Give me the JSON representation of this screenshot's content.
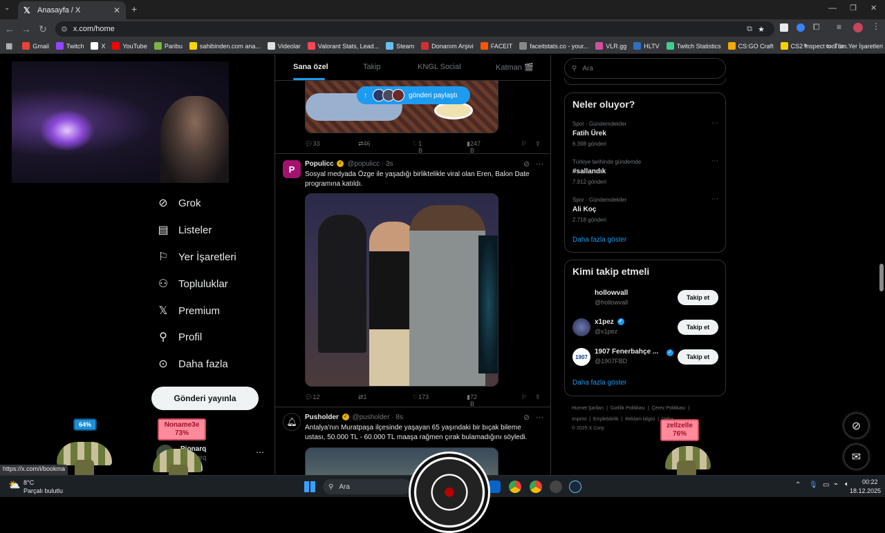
{
  "browser": {
    "tab_title": "Anasayfa / X",
    "url": "x.com/home",
    "status_url": "https://x.com/i/bookma",
    "bookmarks": [
      {
        "label": "Gmail",
        "color": "#ea4335"
      },
      {
        "label": "Twitch",
        "color": "#9146ff"
      },
      {
        "label": "X",
        "color": "#ffffff"
      },
      {
        "label": "YouTube",
        "color": "#ff0000"
      },
      {
        "label": "Paribu",
        "color": "#7cb342"
      },
      {
        "label": "sahibinden.com ana...",
        "color": "#ffd600"
      },
      {
        "label": "Videolar",
        "color": "#e0e0e0"
      },
      {
        "label": "Valorant Stats, Lead...",
        "color": "#ff4655"
      },
      {
        "label": "Steam",
        "color": "#66c0f4"
      },
      {
        "label": "Donanım Arşivi",
        "color": "#d32f2f"
      },
      {
        "label": "FACEIT",
        "color": "#ff5500"
      },
      {
        "label": "faceitstats.co - your...",
        "color": "#888888"
      },
      {
        "label": "VLR.gg",
        "color": "#d050a0"
      },
      {
        "label": "HLTV",
        "color": "#2f6fbf"
      },
      {
        "label": "Twitch Statistics",
        "color": "#3ccf8e"
      },
      {
        "label": "CS:GO Craft",
        "color": "#f2a900"
      },
      {
        "label": "CS2 Inspect tool to...",
        "color": "#f7d000"
      }
    ],
    "bookmarks_all": "Tüm Yer İşaretleri"
  },
  "sidebar": {
    "items": [
      {
        "label": "Grok",
        "icon": "grok-icon"
      },
      {
        "label": "Listeler",
        "icon": "list-icon"
      },
      {
        "label": "Yer İşaretleri",
        "icon": "bookmark-icon"
      },
      {
        "label": "Topluluklar",
        "icon": "communities-icon"
      },
      {
        "label": "Premium",
        "icon": "x-icon"
      },
      {
        "label": "Profil",
        "icon": "profile-icon"
      },
      {
        "label": "Daha fazla",
        "icon": "more-icon"
      }
    ],
    "post_button": "Gönderi yayınla",
    "account_name": "Pionarq",
    "account_handle": "arq"
  },
  "timeline": {
    "tabs": [
      "Sana özel",
      "Takip",
      "KNGL Social",
      "Katman 🎬"
    ],
    "share_pill": "gönderi paylaştı",
    "tweets": [
      {
        "stats": {
          "replies": "33",
          "reposts": "46",
          "likes": "1 B",
          "views": "247 B"
        }
      },
      {
        "name": "Populicc",
        "handle": "@populicc · 3s",
        "text": "Sosyal medyada Özge ile yaşadığı birliktelikle viral olan Eren, Balon Date programına katıldı.",
        "stats": {
          "replies": "12",
          "reposts": "1",
          "likes": "173",
          "views": "72 B"
        }
      },
      {
        "name": "Pusholder",
        "handle": "@pusholder · 8s",
        "text": "Antalya'nın Muratpaşa ilçesinde yaşayan 65 yaşındaki bir bıçak bileme ustası, 50.000 TL - 60.000 TL maaşa rağmen çırak bulamadığını söyledi."
      }
    ]
  },
  "right": {
    "search_placeholder": "Ara",
    "trends_title": "Neler oluyor?",
    "trends": [
      {
        "meta": "Spor · Gündemdekiler",
        "name": "Fatih Ürek",
        "count": "6.398 gönderi"
      },
      {
        "meta": "Türkiye tarihinde gündemde",
        "name": "#sallandık",
        "count": "7.912 gönderi"
      },
      {
        "meta": "Spor · Gündemdekiler",
        "name": "Ali Koç",
        "count": "2.718 gönderi"
      }
    ],
    "show_more": "Daha fazla göster",
    "wtf_title": "Kimi takip etmeli",
    "who_to_follow": [
      {
        "name": "hollowvall",
        "handle": "@hollowvall"
      },
      {
        "name": "x1pez",
        "handle": "@x1pez"
      },
      {
        "name": "1907 Fenerbahçe ...",
        "handle": "@1907FBD"
      }
    ],
    "follow_label": "Takip et",
    "footer": [
      "Hizmet Şartları",
      "Gizlilik Politikası",
      "Çerez Politikası",
      "Imprint",
      "Erişilebilirlik",
      "Reklam bilgisi",
      "Daha ...",
      "© 2025 X Corp."
    ]
  },
  "overlays": {
    "blue_badge": "64%",
    "pink_left": [
      "Noname3e",
      "73%"
    ],
    "pink_right": [
      "zellzelle",
      "76%"
    ]
  },
  "taskbar": {
    "weather_temp": "8°C",
    "weather_desc": "Parçalı bulutlu",
    "search": "Ara",
    "time": "00:22",
    "date": "18.12.2025"
  }
}
